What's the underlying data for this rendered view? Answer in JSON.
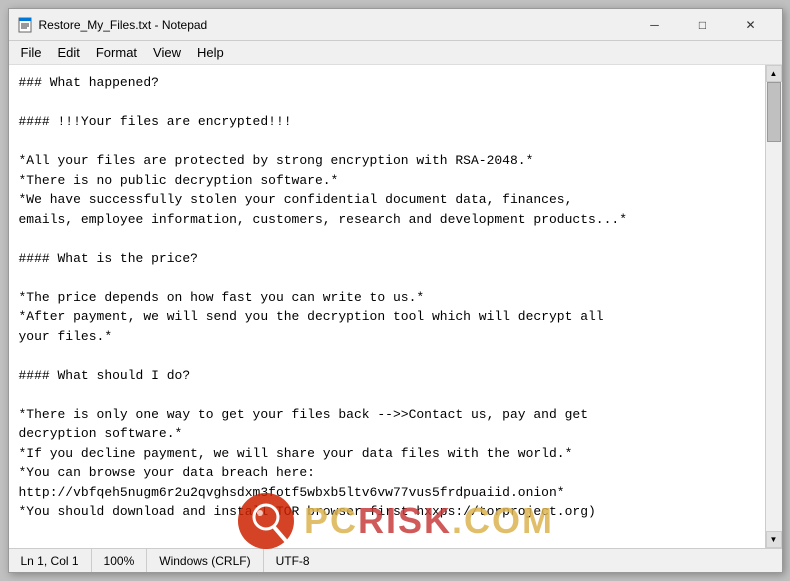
{
  "window": {
    "title": "Restore_My_Files.txt - Notepad",
    "icon": "notepad"
  },
  "menu": {
    "items": [
      "File",
      "Edit",
      "Format",
      "View",
      "Help"
    ]
  },
  "content": {
    "text": "### What happened?\n\n#### !!!Your files are encrypted!!!\n\n*All your files are protected by strong encryption with RSA-2048.*\n*There is no public decryption software.*\n*We have successfully stolen your confidential document data, finances,\nemails, employee information, customers, research and development products...*\n\n#### What is the price?\n\n*The price depends on how fast you can write to us.*\n*After payment, we will send you the decryption tool which will decrypt all\nyour files.*\n\n#### What should I do?\n\n*There is only one way to get your files back -->>Contact us, pay and get\ndecryption software.*\n*If you decline payment, we will share your data files with the world.*\n*You can browse your data breach here:\nhttp://vbfqeh5nugm6r2u2qvghsdxm3fotf5wbxb5ltv6vw77vus5frdpuaiid.onion*\n*You should download and install TOR browser first hxxps://torproject.org)"
  },
  "statusBar": {
    "line": "Ln 1, Col 1",
    "zoom": "100%",
    "lineEnding": "Windows (CRLF)",
    "encoding": "UTF-8"
  },
  "titleBtns": {
    "minimize": "─",
    "maximize": "□",
    "close": "✕"
  }
}
